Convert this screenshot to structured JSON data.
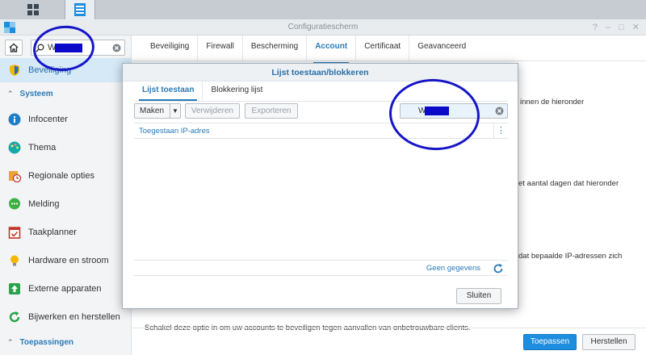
{
  "window": {
    "title": "Configuratiescherm"
  },
  "colors": {
    "accent": "#2a7bb8",
    "primary_button": "#1d8ddf",
    "annotation": "#1616c8",
    "redaction": "#0a0ac8"
  },
  "sidebar": {
    "search_value": "W",
    "items": [
      {
        "label": "Beveiliging",
        "icon": "shield-icon"
      },
      {
        "section": "Systeem"
      },
      {
        "label": "Infocenter",
        "icon": "info-icon"
      },
      {
        "label": "Thema",
        "icon": "palette-icon"
      },
      {
        "label": "Regionale opties",
        "icon": "clock-map-icon"
      },
      {
        "label": "Melding",
        "icon": "chat-icon"
      },
      {
        "label": "Taakplanner",
        "icon": "calendar-icon"
      },
      {
        "label": "Hardware en stroom",
        "icon": "bulb-icon"
      },
      {
        "label": "Externe apparaten",
        "icon": "upload-icon"
      },
      {
        "label": "Bijwerken en herstellen",
        "icon": "refresh-icon"
      },
      {
        "section": "Toepassingen"
      }
    ]
  },
  "tabs": [
    "Beveiliging",
    "Firewall",
    "Bescherming",
    "Account",
    "Certificaat",
    "Geavanceerd"
  ],
  "background_text": {
    "line1": "innen de hieronder",
    "line2": "et aantal dagen dat hieronder",
    "line3": "dat bepaalde IP-adressen zich",
    "line4": "Schakel deze optie in om uw accounts te beveiligen tegen aanvallen van onbetrouwbare clients."
  },
  "buttons": {
    "apply": "Toepassen",
    "reset": "Herstellen"
  },
  "modal": {
    "title": "Lijst toestaan/blokkeren",
    "tabs": [
      "Lijst toestaan",
      "Blokkering lijst"
    ],
    "toolbar": {
      "create": "Maken",
      "delete": "Verwijderen",
      "export": "Exporteren"
    },
    "search_value": "W",
    "column": "Toegestaan IP-adres",
    "empty_text": "Geen gegevens",
    "close": "Sluiten"
  }
}
